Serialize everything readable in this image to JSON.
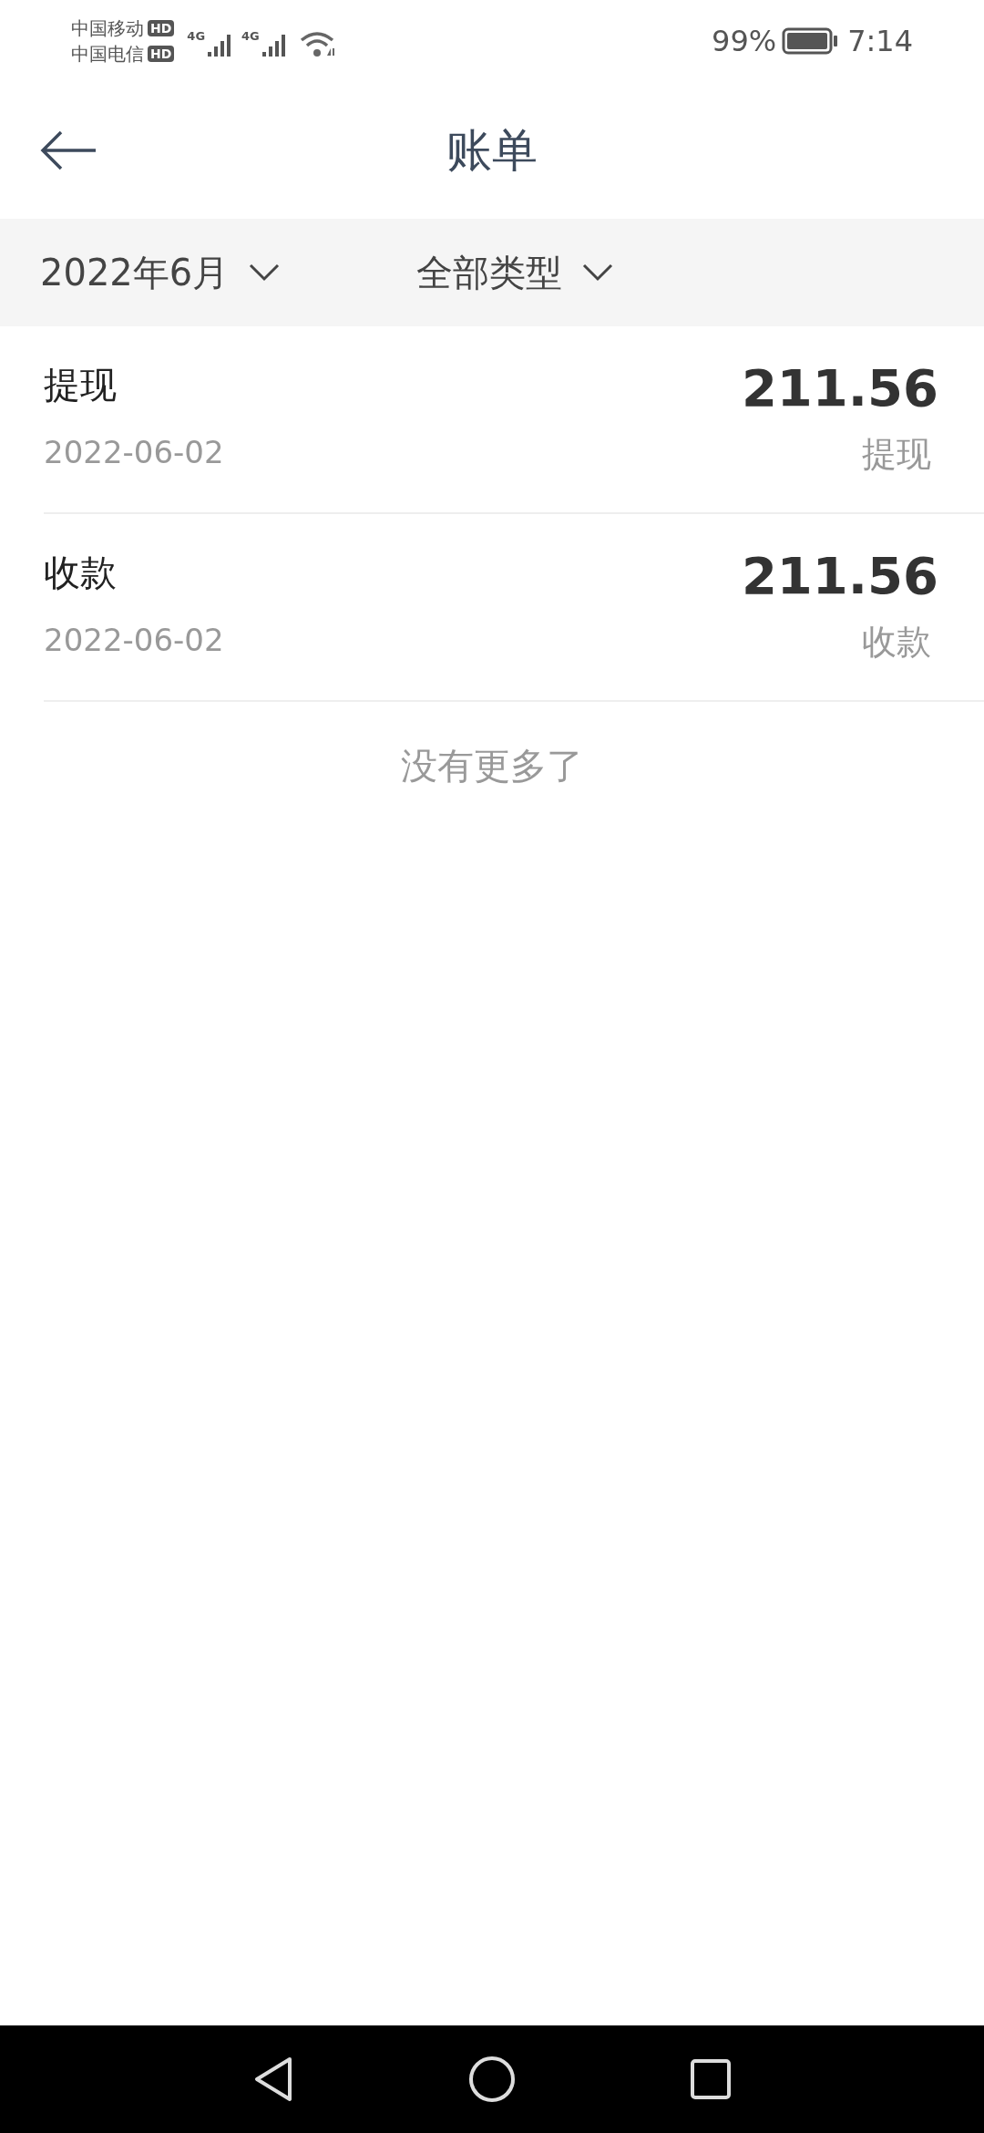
{
  "status_bar": {
    "carriers": [
      {
        "name": "中国移动",
        "badge": "HD",
        "network": "4G"
      },
      {
        "name": "中国电信",
        "badge": "HD",
        "network": "4G"
      }
    ],
    "battery": "99%",
    "time": "7:14"
  },
  "header": {
    "title": "账单"
  },
  "filters": [
    {
      "label": "2022年6月"
    },
    {
      "label": "全部类型"
    }
  ],
  "transactions": [
    {
      "name": "提现",
      "date": "2022-06-02",
      "amount": "211.56",
      "type": "提现"
    },
    {
      "name": "收款",
      "date": "2022-06-02",
      "amount": "211.56",
      "type": "收款"
    }
  ],
  "footer_note": "没有更多了"
}
